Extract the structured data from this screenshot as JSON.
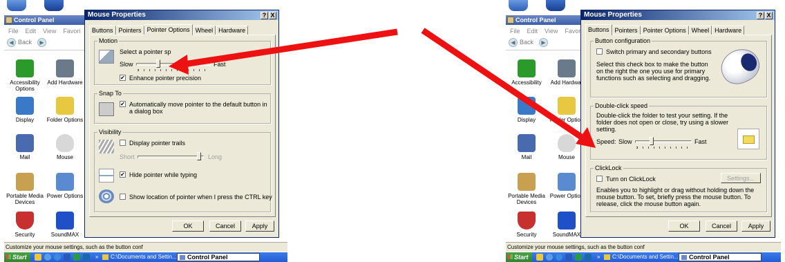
{
  "left": {
    "control_panel": {
      "title": "Control Panel",
      "menu": [
        "File",
        "Edit",
        "View",
        "Favori"
      ],
      "back_label": "Back",
      "icons": [
        {
          "label": "Accessibility Options",
          "color": "#2a9a2a"
        },
        {
          "label": "Add Hardware",
          "color": "#6a7a8a"
        },
        {
          "label": "Display",
          "color": "#3a78c8"
        },
        {
          "label": "Folder Options",
          "color": "#e8c840"
        },
        {
          "label": "Mail",
          "color": "#4a6ab0"
        },
        {
          "label": "Mouse",
          "color": "#d8d8d8"
        },
        {
          "label": "Portable Media Devices",
          "color": "#c8a050"
        },
        {
          "label": "Power Options",
          "color": "#5a8ad0"
        },
        {
          "label": "Security",
          "color": "#c83030"
        },
        {
          "label": "SoundMAX",
          "color": "#2050c8"
        }
      ],
      "status_text": "Customize your mouse settings, such as the button conf"
    },
    "taskbar": {
      "start": "Start",
      "more": "»",
      "folder_item": "C:\\Documents and Settin...",
      "active_item": "Control Panel"
    },
    "dialog": {
      "title": "Mouse Properties",
      "title_buttons": [
        "?",
        "X"
      ],
      "tabs": [
        "Buttons",
        "Pointers",
        "Pointer Options",
        "Wheel",
        "Hardware"
      ],
      "active_tab": "Pointer Options",
      "motion": {
        "group": "Motion",
        "prompt": "Select a pointer sp",
        "slow": "Slow",
        "fast": "Fast",
        "speed_fraction": 0.28,
        "enhance": "Enhance pointer precision",
        "enhance_checked": true
      },
      "snap_to": {
        "group": "Snap To",
        "text": "Automatically move pointer to the default button in a dialog box",
        "checked": true
      },
      "visibility": {
        "group": "Visibility",
        "trails": "Display pointer trails",
        "trails_checked": false,
        "short": "Short",
        "long": "Long",
        "hide": "Hide pointer while typing",
        "hide_checked": true,
        "show_location": "Show location of pointer when I press the CTRL key",
        "show_location_checked": false
      },
      "buttons": {
        "ok": "OK",
        "cancel": "Cancel",
        "apply": "Apply"
      }
    }
  },
  "right": {
    "control_panel": {
      "title": "Control Panel",
      "menu": [
        "File",
        "Edit",
        "View",
        "Favori"
      ],
      "back_label": "Back",
      "icons": [
        {
          "label": "Accessibility",
          "color": "#2a9a2a"
        },
        {
          "label": "Add Hardwar",
          "color": "#6a7a8a"
        },
        {
          "label": "Display",
          "color": "#3a78c8"
        },
        {
          "label": "Folder Option",
          "color": "#e8c840"
        },
        {
          "label": "Mail",
          "color": "#4a6ab0"
        },
        {
          "label": "Mouse",
          "color": "#d8d8d8"
        },
        {
          "label": "Portable Media Devices",
          "color": "#c8a050"
        },
        {
          "label": "Power Option",
          "color": "#5a8ad0"
        },
        {
          "label": "Security",
          "color": "#c83030"
        },
        {
          "label": "SoundMAX",
          "color": "#2050c8"
        }
      ],
      "status_text": "Customize your mouse settings, such as the button conf"
    },
    "taskbar": {
      "start": "Start",
      "more": "»",
      "folder_item": "C:\\Documents and Settin...",
      "active_item": "Control Panel"
    },
    "dialog": {
      "title": "Mouse Properties",
      "title_buttons": [
        "?",
        "X"
      ],
      "tabs": [
        "Buttons",
        "Pointers",
        "Pointer Options",
        "Wheel",
        "Hardware"
      ],
      "active_tab": "Buttons",
      "button_config": {
        "group": "Button configuration",
        "switch": "Switch primary and secondary buttons",
        "switch_checked": false,
        "desc": "Select this check box to make the button on the right the one you use for primary functions such as selecting and dragging."
      },
      "double_click": {
        "group": "Double-click speed",
        "desc": "Double-click the folder to test your setting. If the folder does not open or close, try using a slower setting.",
        "speed": "Speed:",
        "slow": "Slow",
        "fast": "Fast",
        "speed_fraction": 0.28
      },
      "clicklock": {
        "group": "ClickLock",
        "turn_on": "Turn on ClickLock",
        "checked": false,
        "settings": "Settings...",
        "desc": "Enables you to highlight or drag without holding down the mouse button. To set, briefly press the mouse button. To release, click the mouse button again."
      },
      "buttons": {
        "ok": "OK",
        "cancel": "Cancel",
        "apply": "Apply"
      }
    }
  },
  "annotation": {
    "arrow_color": "#ee1111"
  }
}
